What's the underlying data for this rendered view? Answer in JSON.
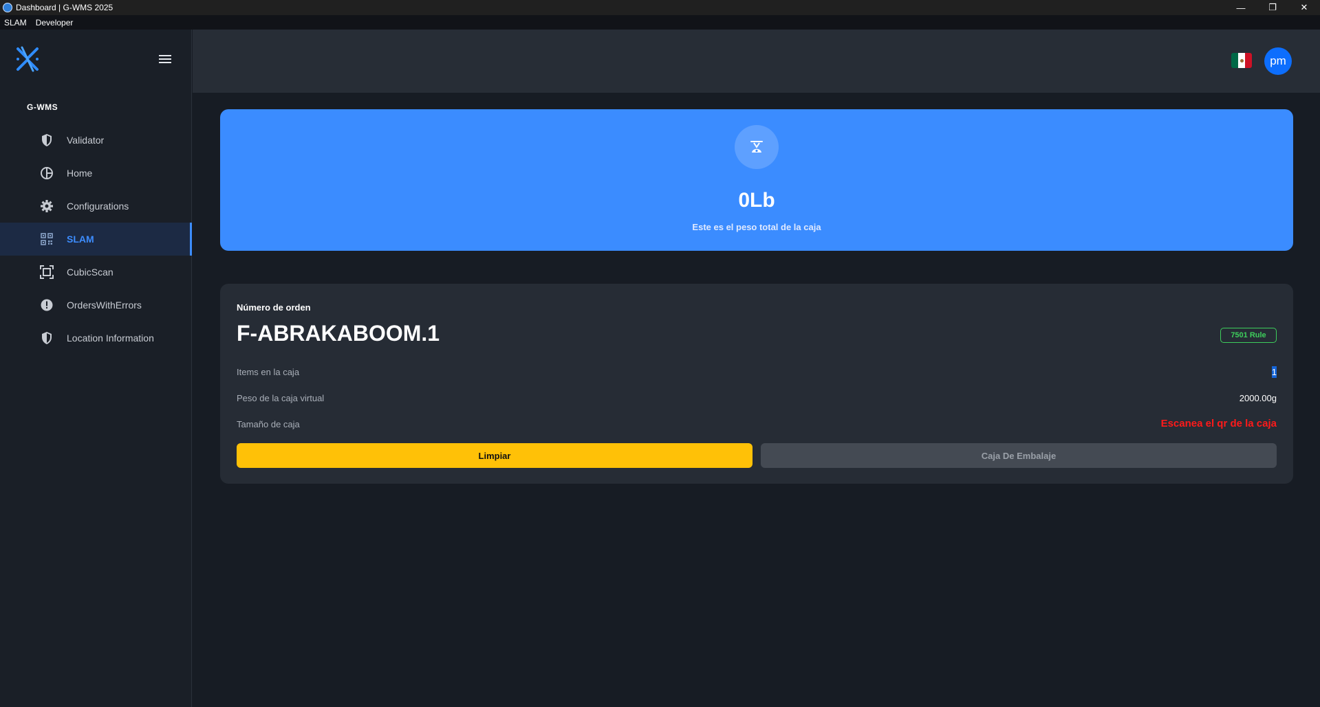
{
  "window": {
    "title": "Dashboard | G-WMS 2025",
    "controls": {
      "minimize": "—",
      "restore": "❐",
      "close": "✕"
    }
  },
  "menubar": {
    "items": [
      "SLAM",
      "Developer"
    ]
  },
  "sidebar": {
    "section_label": "G-WMS",
    "items": [
      {
        "label": "Validator",
        "icon": "shield-icon",
        "active": false
      },
      {
        "label": "Home",
        "icon": "globe-icon",
        "active": false
      },
      {
        "label": "Configurations",
        "icon": "gear-icon",
        "active": false
      },
      {
        "label": "SLAM",
        "icon": "qr-code-icon",
        "active": true
      },
      {
        "label": "CubicScan",
        "icon": "scan-frame-icon",
        "active": false
      },
      {
        "label": "OrdersWithErrors",
        "icon": "exclamation-circle-icon",
        "active": false
      },
      {
        "label": "Location Information",
        "icon": "shield-icon",
        "active": false
      }
    ]
  },
  "header": {
    "avatar_initials": "pm",
    "flag": "mexico-flag",
    "colors": {
      "avatar": "#0d6efd"
    }
  },
  "weight": {
    "value": "0Lb",
    "caption": "Este es el peso total de la caja",
    "icon": "scale-icon",
    "colors": {
      "card": "#3b8cff"
    }
  },
  "order": {
    "label": "Número de orden",
    "number": "F-ABRAKABOOM.1",
    "badge": "7501 Rule",
    "rows": [
      {
        "label": "Items en la caja",
        "value": "1"
      },
      {
        "label": "Peso de la caja virtual",
        "value": "2000.00g"
      },
      {
        "label": "Tamaño de caja",
        "value": "Escanea el qr de la caja"
      }
    ],
    "buttons": {
      "clear": "Limpiar",
      "pack": "Caja De Embalaje"
    },
    "colors": {
      "clear": "#ffc107",
      "pack": "#444a53",
      "warning": "#ff1a1a",
      "badge": "#3ecf5c"
    }
  }
}
